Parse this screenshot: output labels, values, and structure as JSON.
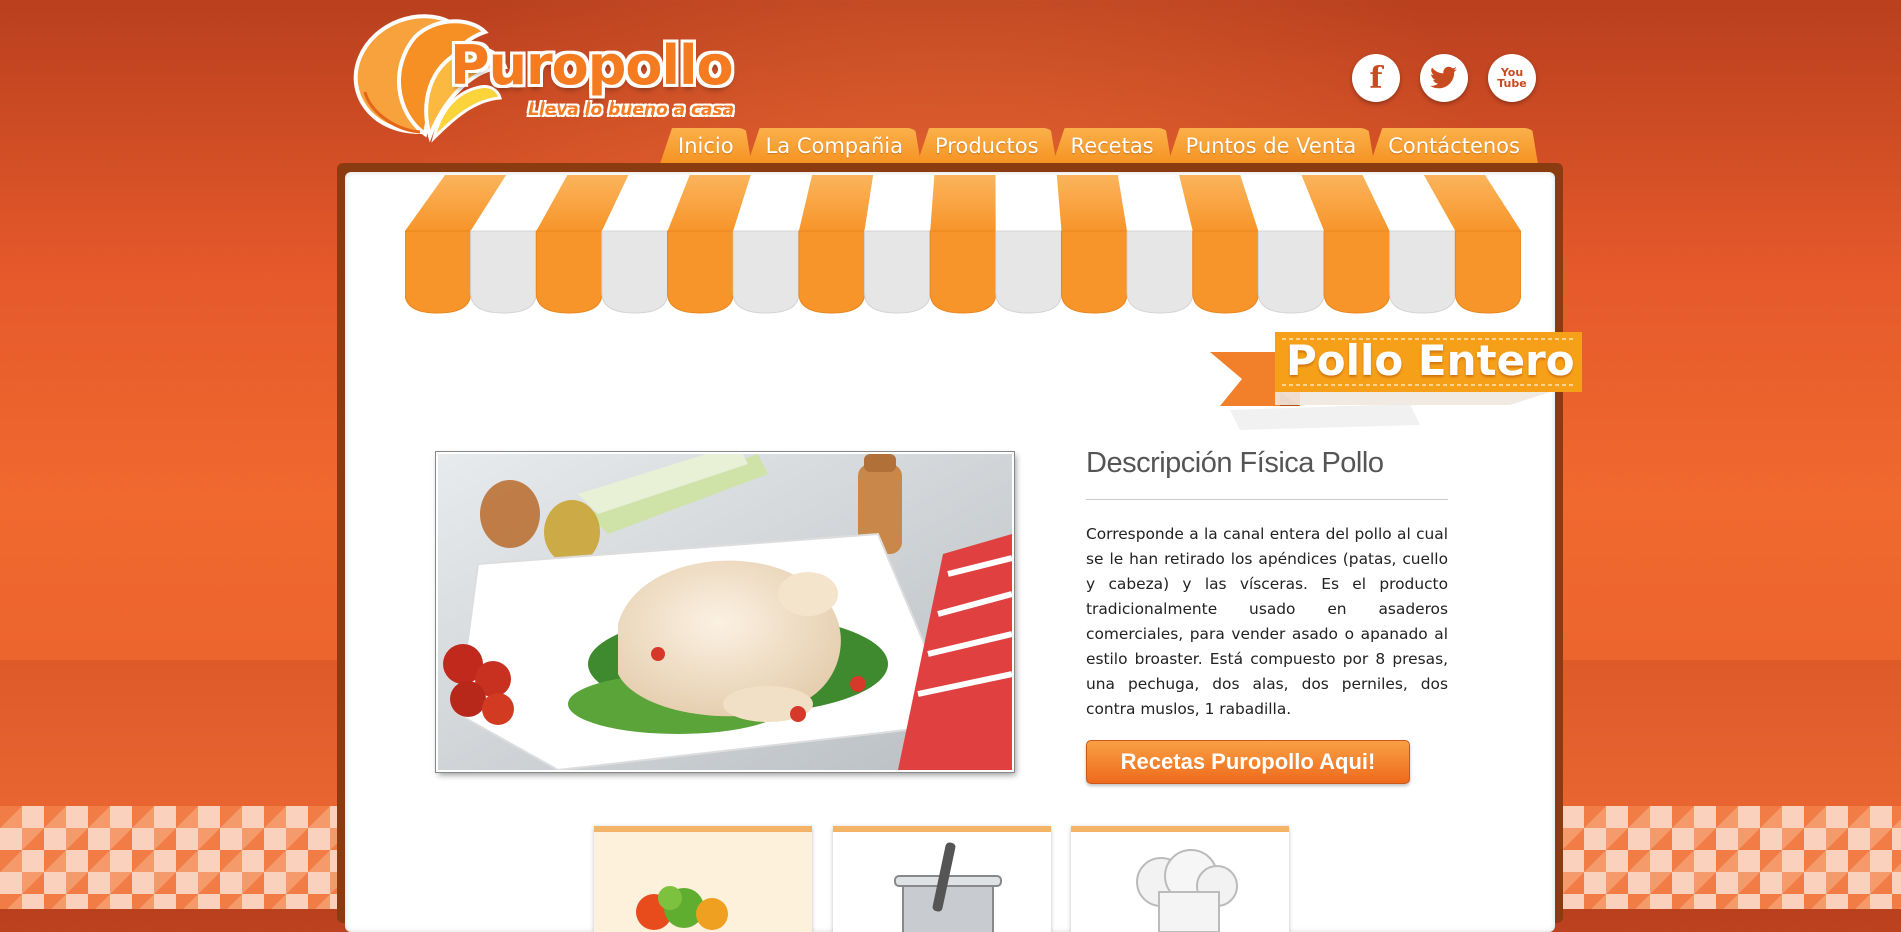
{
  "brand": {
    "name": "Puropollo",
    "tagline": "Lleva lo bueno a casa",
    "primary_color": "#f57b20",
    "background_color": "#e5592b"
  },
  "social": [
    {
      "name": "facebook-icon",
      "glyph": "f"
    },
    {
      "name": "twitter-icon",
      "glyph": ""
    },
    {
      "name": "youtube-icon",
      "glyph": "You Tube"
    }
  ],
  "nav": {
    "items": [
      "Inicio",
      "La Compañia",
      "Productos",
      "Recetas",
      "Puntos de Venta",
      "Contáctenos"
    ]
  },
  "product": {
    "title": "Pollo Entero",
    "desc_title": "Descripción Física Pollo",
    "description": "Corresponde a la canal entera del pollo al cual se le han retirado los apéndices (patas, cuello y cabeza) y las vísceras.  Es el producto tradicionalmente usado en asaderos comerciales, para vender asado o apanado al estilo broaster.  Está compuesto por 8 presas, una pechuga, dos alas, dos perniles, dos contra muslos, 1 rabadilla.",
    "cta_label": "Recetas Puropollo Aqui!"
  },
  "cards": [
    {
      "name": "card-vegetables",
      "icon": "vegetables-icon"
    },
    {
      "name": "card-cooking-pot",
      "icon": "cooking-pot-icon"
    },
    {
      "name": "card-chef-hat",
      "icon": "chef-hat-icon"
    }
  ]
}
